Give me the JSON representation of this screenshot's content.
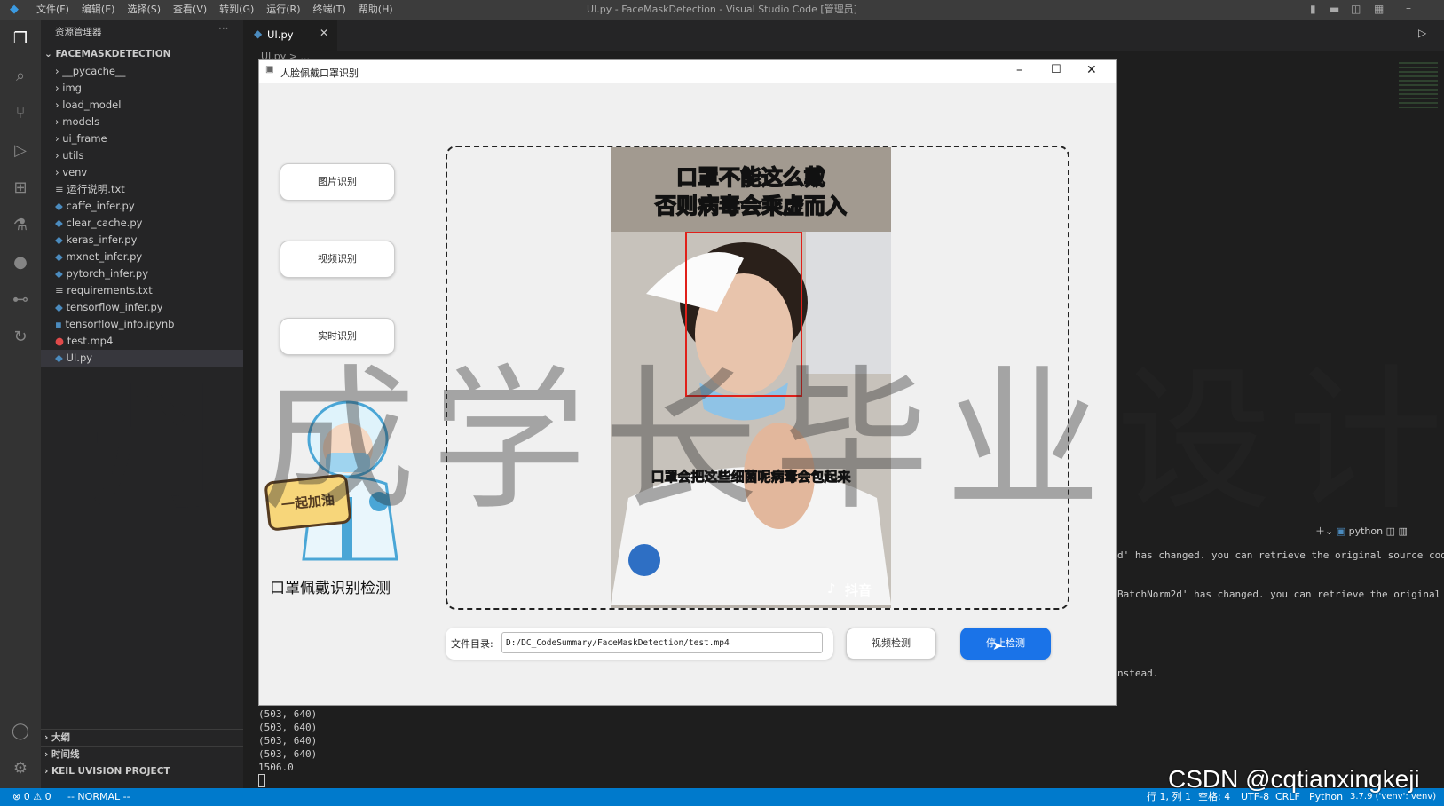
{
  "vscode": {
    "menus": [
      "文件(F)",
      "编辑(E)",
      "选择(S)",
      "查看(V)",
      "转到(G)",
      "运行(R)",
      "终端(T)",
      "帮助(H)"
    ],
    "window_title": "UI.py - FaceMaskDetection - Visual Studio Code [管理员]",
    "sidebar_title": "资源管理器",
    "project_name": "FACEMASKDETECTION",
    "files": [
      "__pycache__",
      "img",
      "load_model",
      "models",
      "ui_frame",
      "utils",
      "venv",
      "运行说明.txt",
      "caffe_infer.py",
      "clear_cache.py",
      "keras_infer.py",
      "mxnet_infer.py",
      "pytorch_infer.py",
      "requirements.txt",
      "tensorflow_infer.py",
      "tensorflow_info.ipynb",
      "test.mp4",
      "UI.py"
    ],
    "bottom_sections": [
      "大纲",
      "时间线",
      "KEIL UVISION PROJECT"
    ],
    "tab_label": "UI.py",
    "breadcrumb": "UI.py > ...",
    "terminal_profile": "python",
    "terminal_output": [
      "(503, 640)",
      "(503, 640)",
      "(503, 640)",
      "(503, 640)",
      "1506.0"
    ],
    "terminal_right": [
      "d' has changed. you can retrieve the original source code by",
      "BatchNorm2d' has changed. you can retrieve the original sour",
      "nstead."
    ],
    "status": {
      "problems": "⊗ 0 ⚠ 0",
      "mode": "-- NORMAL --",
      "position": "行 1, 列 1",
      "spaces": "空格: 4",
      "encoding": "UTF-8",
      "eol": "CRLF",
      "language": "Python",
      "interpreter": "3.7.9 ('venv': venv)"
    }
  },
  "app": {
    "title": "人脸佩戴口罩识别",
    "buttons": {
      "image": "图片识别",
      "video": "视频识别",
      "realtime": "实时识别"
    },
    "mascot_sign": "一起加油",
    "heading": "口罩佩戴识别检测",
    "video_caption_top_1": "口罩不能这么戴",
    "video_caption_top_2": "否则病毒会乘虚而入",
    "video_caption_bottom": "口罩会把这些细菌呢病毒会包起来",
    "video_logo": "抖音",
    "file_label": "文件目录:",
    "file_path": "D:/DC_CodeSummary/FaceMaskDetection/test.mp4",
    "detect_button": "视频检测",
    "stop_button": "停止检测"
  },
  "overlay": {
    "watermark": "丹成学长毕业设计",
    "credit": "CSDN @cqtianxingkeji"
  },
  "colors": {
    "accent": "#1a73e8",
    "statusbar": "#007acc",
    "detection_box": "#e0201a"
  }
}
